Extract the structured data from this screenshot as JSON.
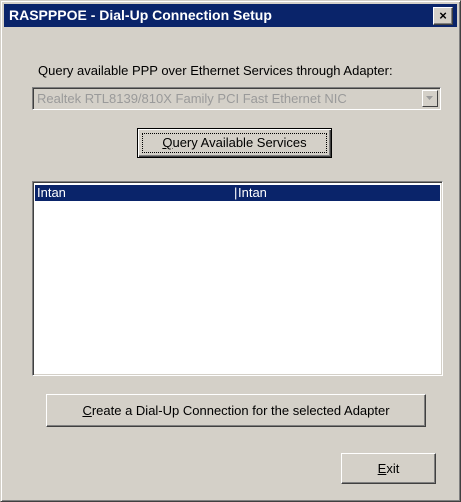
{
  "window": {
    "title": "RASPPPOE - Dial-Up Connection Setup",
    "close_symbol": "×"
  },
  "adapter": {
    "label": "Query available PPP over Ethernet Services through Adapter:",
    "selected": "Realtek RTL8139/810X Family PCI Fast Ethernet NIC",
    "enabled": false
  },
  "query_button": {
    "label": "Query Available Services",
    "mnemonic": "Q",
    "rest": "uery Available Services"
  },
  "services": {
    "rows": [
      {
        "service": "Intan",
        "ac": "Intan",
        "selected": true
      }
    ]
  },
  "create_button": {
    "label": "Create a Dial-Up Connection for the selected Adapter",
    "mnemonic": "C",
    "rest": "reate a Dial-Up Connection for the selected Adapter"
  },
  "exit_button": {
    "label": "Exit",
    "mnemonic": "E",
    "rest": "xit"
  },
  "colors": {
    "face": "#d4d0c8",
    "title_bar": "#0a246a",
    "selection": "#0a246a",
    "disabled_text": "#9a9a9a"
  },
  "icons": {
    "close": "close-icon",
    "dropdown": "chevron-down-icon"
  }
}
